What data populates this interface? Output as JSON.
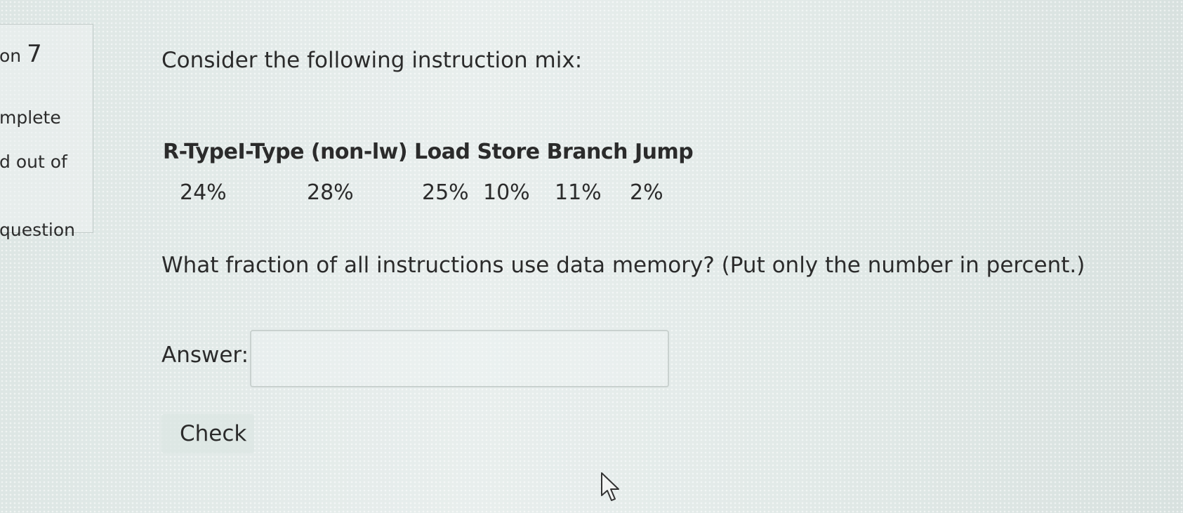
{
  "info": {
    "question_prefix": "on",
    "question_number": "7",
    "state": "mplete",
    "mark": "d out of",
    "flag": "question"
  },
  "question": {
    "intro": "Consider the following instruction mix:",
    "mix": [
      {
        "type": "R-Type",
        "percent": "24%"
      },
      {
        "type": "I-Type (non-lw)",
        "percent": "28%"
      },
      {
        "type": "Load",
        "percent": "25%"
      },
      {
        "type": "Store",
        "percent": "10%"
      },
      {
        "type": "Branch",
        "percent": "11%"
      },
      {
        "type": "Jump",
        "percent": "2%"
      }
    ],
    "prompt": "What fraction of all instructions use data memory? (Put only the number in percent.)",
    "answer_label": "Answer:",
    "answer_value": "",
    "check_label": "Check"
  },
  "icons": {
    "cursor": "mouse-pointer-icon"
  }
}
